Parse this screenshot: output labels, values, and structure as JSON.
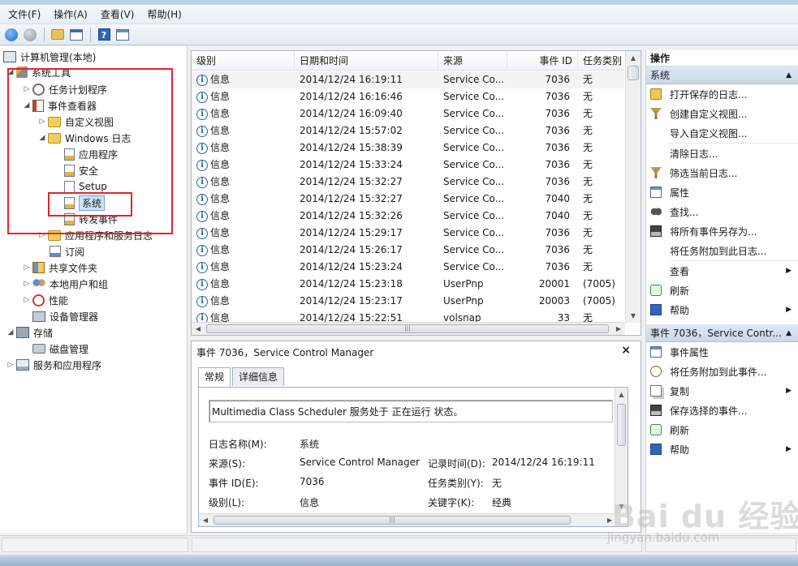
{
  "menubar": {
    "items": [
      "文件(F)",
      "操作(A)",
      "查看(V)",
      "帮助(H)"
    ]
  },
  "toolbar": {
    "icons": [
      "back-icon",
      "forward-icon",
      "folder-up-icon",
      "console-tree-icon",
      "help-icon",
      "view-icon"
    ]
  },
  "tree": {
    "root": "计算机管理(本地)",
    "system_tools": "系统工具",
    "task_scheduler": "任务计划程序",
    "event_viewer": "事件查看器",
    "custom_views": "自定义视图",
    "windows_logs": "Windows 日志",
    "application": "应用程序",
    "security": "安全",
    "setup": "Setup",
    "system": "系统",
    "forwarded": "转发事件",
    "app_service_logs": "应用程序和服务日志",
    "subscriptions": "订阅",
    "shared_folders": "共享文件夹",
    "local_users": "本地用户和组",
    "performance": "性能",
    "device_manager": "设备管理器",
    "storage": "存储",
    "disk_management": "磁盘管理",
    "services_apps": "服务和应用程序"
  },
  "list": {
    "columns": [
      "级别",
      "日期和时间",
      "来源",
      "事件 ID",
      "任务类别"
    ],
    "rows": [
      {
        "level": "信息",
        "datetime": "2014/12/24 16:19:11",
        "source": "Service Co...",
        "id": "7036",
        "category": "无"
      },
      {
        "level": "信息",
        "datetime": "2014/12/24 16:16:46",
        "source": "Service Co...",
        "id": "7036",
        "category": "无"
      },
      {
        "level": "信息",
        "datetime": "2014/12/24 16:09:40",
        "source": "Service Co...",
        "id": "7036",
        "category": "无"
      },
      {
        "level": "信息",
        "datetime": "2014/12/24 15:57:02",
        "source": "Service Co...",
        "id": "7036",
        "category": "无"
      },
      {
        "level": "信息",
        "datetime": "2014/12/24 15:38:39",
        "source": "Service Co...",
        "id": "7036",
        "category": "无"
      },
      {
        "level": "信息",
        "datetime": "2014/12/24 15:33:24",
        "source": "Service Co...",
        "id": "7036",
        "category": "无"
      },
      {
        "level": "信息",
        "datetime": "2014/12/24 15:32:27",
        "source": "Service Co...",
        "id": "7036",
        "category": "无"
      },
      {
        "level": "信息",
        "datetime": "2014/12/24 15:32:27",
        "source": "Service Co...",
        "id": "7040",
        "category": "无"
      },
      {
        "level": "信息",
        "datetime": "2014/12/24 15:32:26",
        "source": "Service Co...",
        "id": "7040",
        "category": "无"
      },
      {
        "level": "信息",
        "datetime": "2014/12/24 15:29:17",
        "source": "Service Co...",
        "id": "7036",
        "category": "无"
      },
      {
        "level": "信息",
        "datetime": "2014/12/24 15:26:17",
        "source": "Service Co...",
        "id": "7036",
        "category": "无"
      },
      {
        "level": "信息",
        "datetime": "2014/12/24 15:23:24",
        "source": "Service Co...",
        "id": "7036",
        "category": "无"
      },
      {
        "level": "信息",
        "datetime": "2014/12/24 15:23:18",
        "source": "UserPnp",
        "id": "20001",
        "category": "(7005)"
      },
      {
        "level": "信息",
        "datetime": "2014/12/24 15:23:17",
        "source": "UserPnp",
        "id": "20003",
        "category": "(7005)"
      },
      {
        "level": "信息",
        "datetime": "2014/12/24 15:22:51",
        "source": "volsnap",
        "id": "33",
        "category": "无"
      }
    ]
  },
  "detail": {
    "title": "事件 7036，Service Control Manager",
    "close": "×",
    "tabs": [
      "常规",
      "详细信息"
    ],
    "message": "Multimedia Class Scheduler 服务处于 正在运行 状态。",
    "log_name_label": "日志名称(M):",
    "log_name_value": "系统",
    "source_label": "来源(S):",
    "source_value": "Service Control Manager",
    "logged_label": "记录时间(D):",
    "logged_value": "2014/12/24 16:19:11",
    "event_id_label": "事件 ID(E):",
    "event_id_value": "7036",
    "task_cat_label": "任务类别(Y):",
    "task_cat_value": "无",
    "level_label": "级别(L):",
    "level_value": "信息",
    "keywords_label": "关键字(K):",
    "keywords_value": "经典"
  },
  "actions": {
    "header": "操作",
    "section1": "系统",
    "items1": [
      {
        "label": "打开保存的日志...",
        "icon": "open-log-icon"
      },
      {
        "label": "创建自定义视图...",
        "icon": "filter-icon"
      },
      {
        "label": "导入自定义视图...",
        "icon": ""
      },
      {
        "label": "清除日志...",
        "icon": ""
      },
      {
        "label": "筛选当前日志...",
        "icon": "filter-icon"
      },
      {
        "label": "属性",
        "icon": "properties-icon"
      },
      {
        "label": "查找...",
        "icon": "find-icon"
      },
      {
        "label": "将所有事件另存为...",
        "icon": "save-icon"
      },
      {
        "label": "将任务附加到此日志...",
        "icon": ""
      },
      {
        "label": "查看",
        "icon": "",
        "submenu": "▶"
      },
      {
        "label": "刷新",
        "icon": "refresh-icon"
      },
      {
        "label": "帮助",
        "icon": "help-icon",
        "submenu": "▶"
      }
    ],
    "section2": "事件 7036，Service Contr...",
    "items2": [
      {
        "label": "事件属性",
        "icon": "event-properties-icon"
      },
      {
        "label": "将任务附加到此事件...",
        "icon": "task-icon"
      },
      {
        "label": "复制",
        "icon": "copy-icon",
        "submenu": "▶"
      },
      {
        "label": "保存选择的事件...",
        "icon": "save-icon"
      },
      {
        "label": "刷新",
        "icon": "refresh-icon"
      },
      {
        "label": "帮助",
        "icon": "help-icon",
        "submenu": "▶"
      }
    ]
  },
  "watermark": {
    "big": "Bai du 经验",
    "small": "jingyan.baidu.com"
  },
  "colors": {
    "highlight_box": "#e1242c",
    "selection": "#cde3f8",
    "section_header": "#c9d8ea"
  }
}
